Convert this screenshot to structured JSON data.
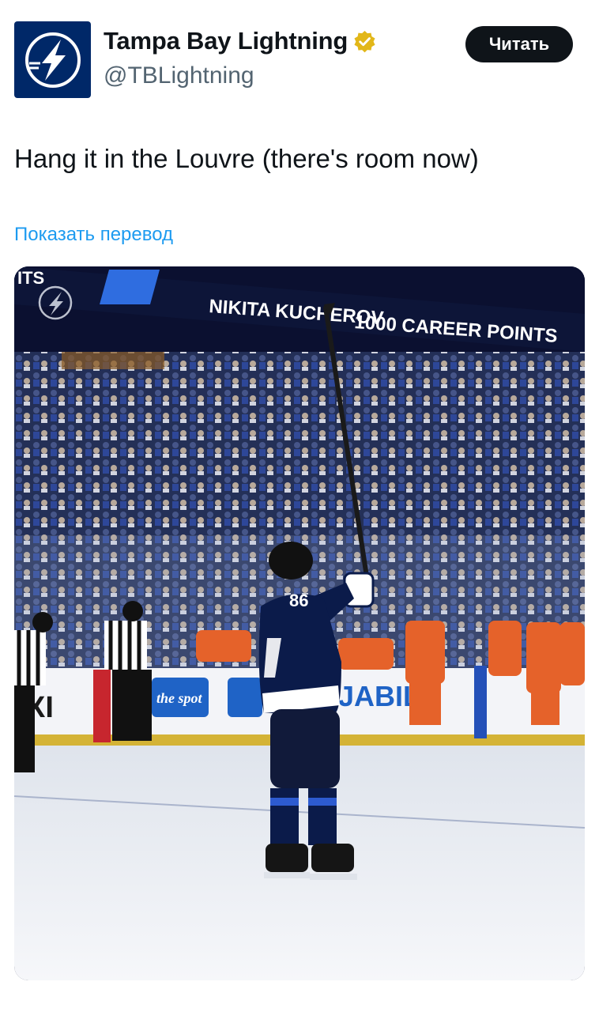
{
  "author": {
    "name": "Tampa Bay Lightning",
    "handle": "@TBLightning",
    "verified": true,
    "avatar_icon": "lightning-bolt-logo"
  },
  "follow_button": {
    "label": "Читать"
  },
  "tweet": {
    "text": "Hang it in the Louvre (there's room now)",
    "translate_link": "Показать перевод"
  },
  "media": {
    "description_icon": "hockey-photo",
    "board_left": "ITS",
    "board_player": "NIKITA KUCHEROV",
    "board_milestone": "1000 CAREER POINTS",
    "jersey_number": "86",
    "ad_spot": "the spot",
    "ad_jabil": "JABIL"
  },
  "colors": {
    "accent": "#1d9bf0",
    "button_bg": "#0f1419",
    "brand_navy": "#002868",
    "verified_gold": "#e2b719"
  }
}
